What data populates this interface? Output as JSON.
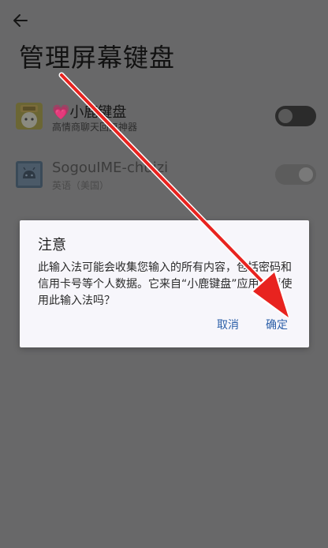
{
  "page": {
    "title": "管理屏幕键盘"
  },
  "keyboards": [
    {
      "title": "💗小鹿键盘",
      "subtitle": "高情商聊天回复神器",
      "icon": "deer-keyboard-icon",
      "enabled": false
    },
    {
      "title": "SogouIME-chuizi",
      "subtitle": "英语（美国）",
      "icon": "android-icon",
      "enabled": true,
      "disabled": true
    }
  ],
  "dialog": {
    "title": "注意",
    "message": "此输入法可能会收集您输入的所有内容，包括密码和信用卡号等个人数据。它来自“小鹿键盘”应用。要使用此输入法吗？",
    "cancel_label": "取消",
    "confirm_label": "确定"
  },
  "colors": {
    "scrim": "#686869",
    "dialog_bg": "#f7f6fb",
    "accent": "#2b5fa8",
    "annotation_arrow": "#e8231f"
  }
}
